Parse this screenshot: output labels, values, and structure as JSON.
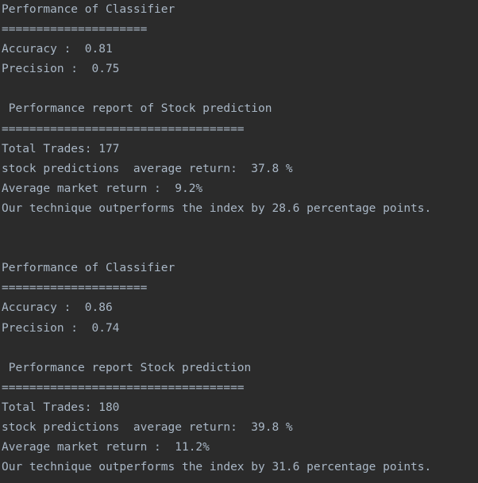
{
  "console": {
    "lines": [
      "Performance of Classifier",
      "=====================",
      "Accuracy :  0.81",
      "Precision :  0.75",
      "",
      " Performance report of Stock prediction",
      "===================================",
      "Total Trades: 177",
      "stock predictions  average return:  37.8 %",
      "Average market return :  9.2%",
      "Our technique outperforms the index by 28.6 percentage points.",
      "",
      "",
      "Performance of Classifier",
      "=====================",
      "Accuracy :  0.86",
      "Precision :  0.74",
      "",
      " Performance report Stock prediction",
      "===================================",
      "Total Trades: 180",
      "stock predictions  average return:  39.8 %",
      "Average market return :  11.2%",
      "Our technique outperforms the index by 31.6 percentage points."
    ]
  },
  "colors": {
    "background": "#2b2b2b",
    "text": "#a9b7c6"
  }
}
